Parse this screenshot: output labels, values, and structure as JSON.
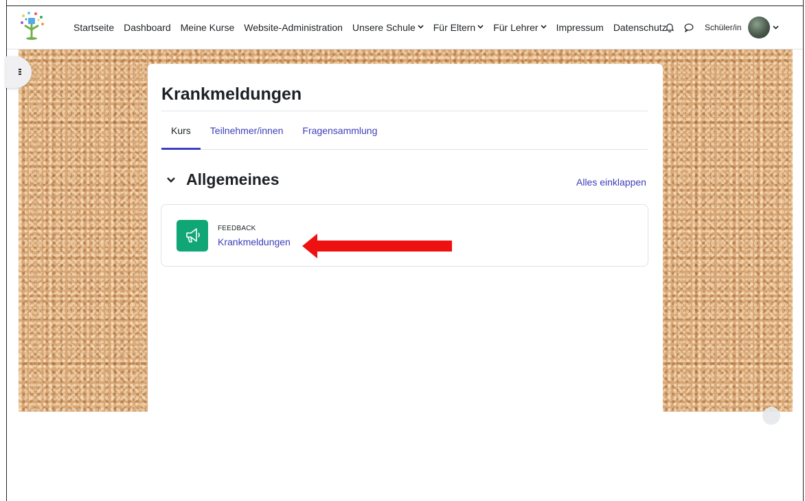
{
  "nav": {
    "items": [
      {
        "label": "Startseite",
        "dropdown": false
      },
      {
        "label": "Dashboard",
        "dropdown": false
      },
      {
        "label": "Meine Kurse",
        "dropdown": false
      },
      {
        "label": "Website-Administration",
        "dropdown": false
      },
      {
        "label": "Unsere Schule",
        "dropdown": true
      },
      {
        "label": "Für Eltern",
        "dropdown": true
      },
      {
        "label": "Für Lehrer",
        "dropdown": true
      },
      {
        "label": "Impressum",
        "dropdown": false
      },
      {
        "label": "Datenschutz",
        "dropdown": false
      }
    ],
    "role": "Schüler/in",
    "icons": [
      "bell-icon",
      "chat-icon",
      "avatar",
      "chevron-down-icon"
    ]
  },
  "course": {
    "title": "Krankmeldungen",
    "tabs": [
      {
        "label": "Kurs",
        "active": true
      },
      {
        "label": "Teilnehmer/innen",
        "active": false
      },
      {
        "label": "Fragensammlung",
        "active": false
      }
    ],
    "section": {
      "title": "Allgemeines",
      "collapse_all": "Alles einklappen"
    },
    "activity": {
      "type": "FEEDBACK",
      "name": "Krankmeldungen",
      "icon": "megaphone-icon"
    }
  },
  "colors": {
    "link": "#3d3dbb",
    "feedback_icon_bg": "#11a676",
    "annotation_arrow": "#ee1111",
    "cork": "#d9a675"
  }
}
